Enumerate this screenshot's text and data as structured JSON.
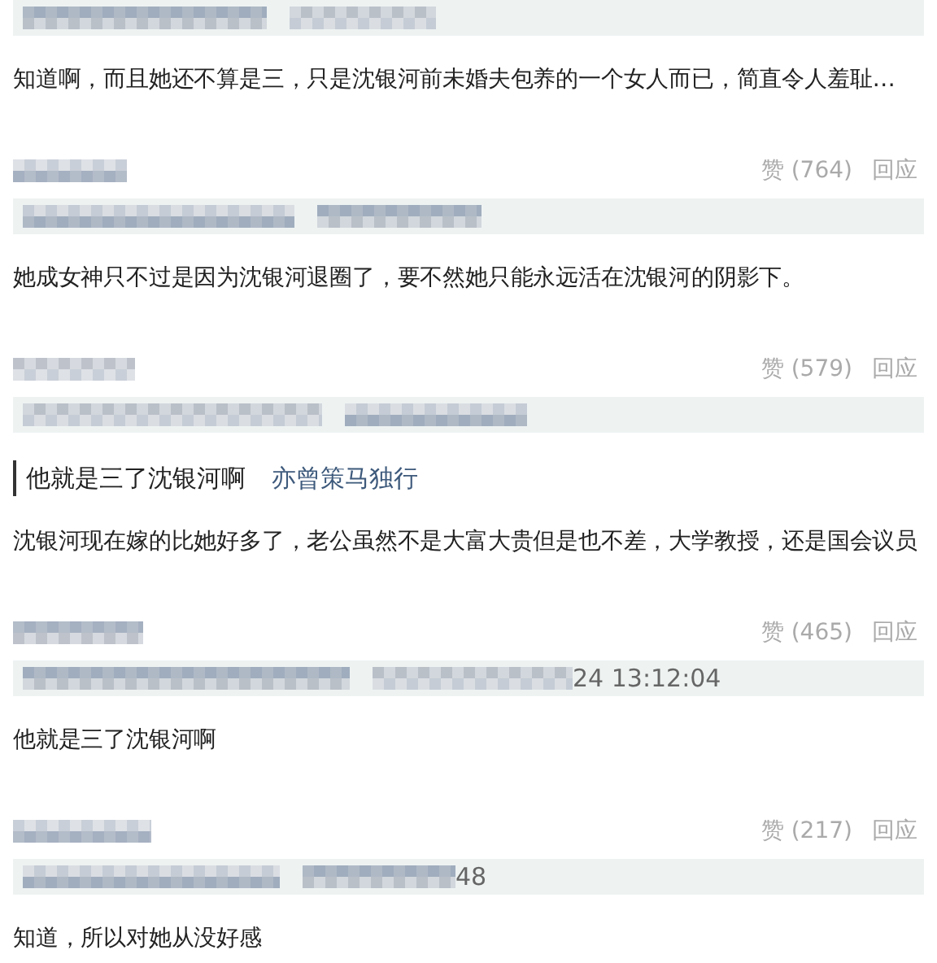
{
  "comments": [
    {
      "body": "知道啊，而且她还不算是三，只是沈银河前未婚夫包养的一个女人而已，简直令人羞耻…",
      "footer": {
        "likes": "赞 (764)",
        "reply": "回应"
      }
    },
    {
      "body": "她成女神只不过是因为沈银河退圈了，要不然她只能永远活在沈银河的阴影下。",
      "footer": {
        "likes": "赞 (579)",
        "reply": "回应"
      }
    },
    {
      "quote": {
        "text": "他就是三了沈银河啊",
        "author": "亦曾策马独行"
      },
      "body": "沈银河现在嫁的比她好多了，老公虽然不是大富大贵但是也不差，大学教授，还是国会议员",
      "footer": {
        "likes": "赞 (465)",
        "reply": "回应"
      }
    },
    {
      "header_text": "24 13:12:04",
      "body": "他就是三了沈银河啊",
      "footer": {
        "likes": "赞 (217)",
        "reply": "回应"
      }
    },
    {
      "header_text": "48",
      "body": "知道，所以对她从没好感"
    }
  ]
}
